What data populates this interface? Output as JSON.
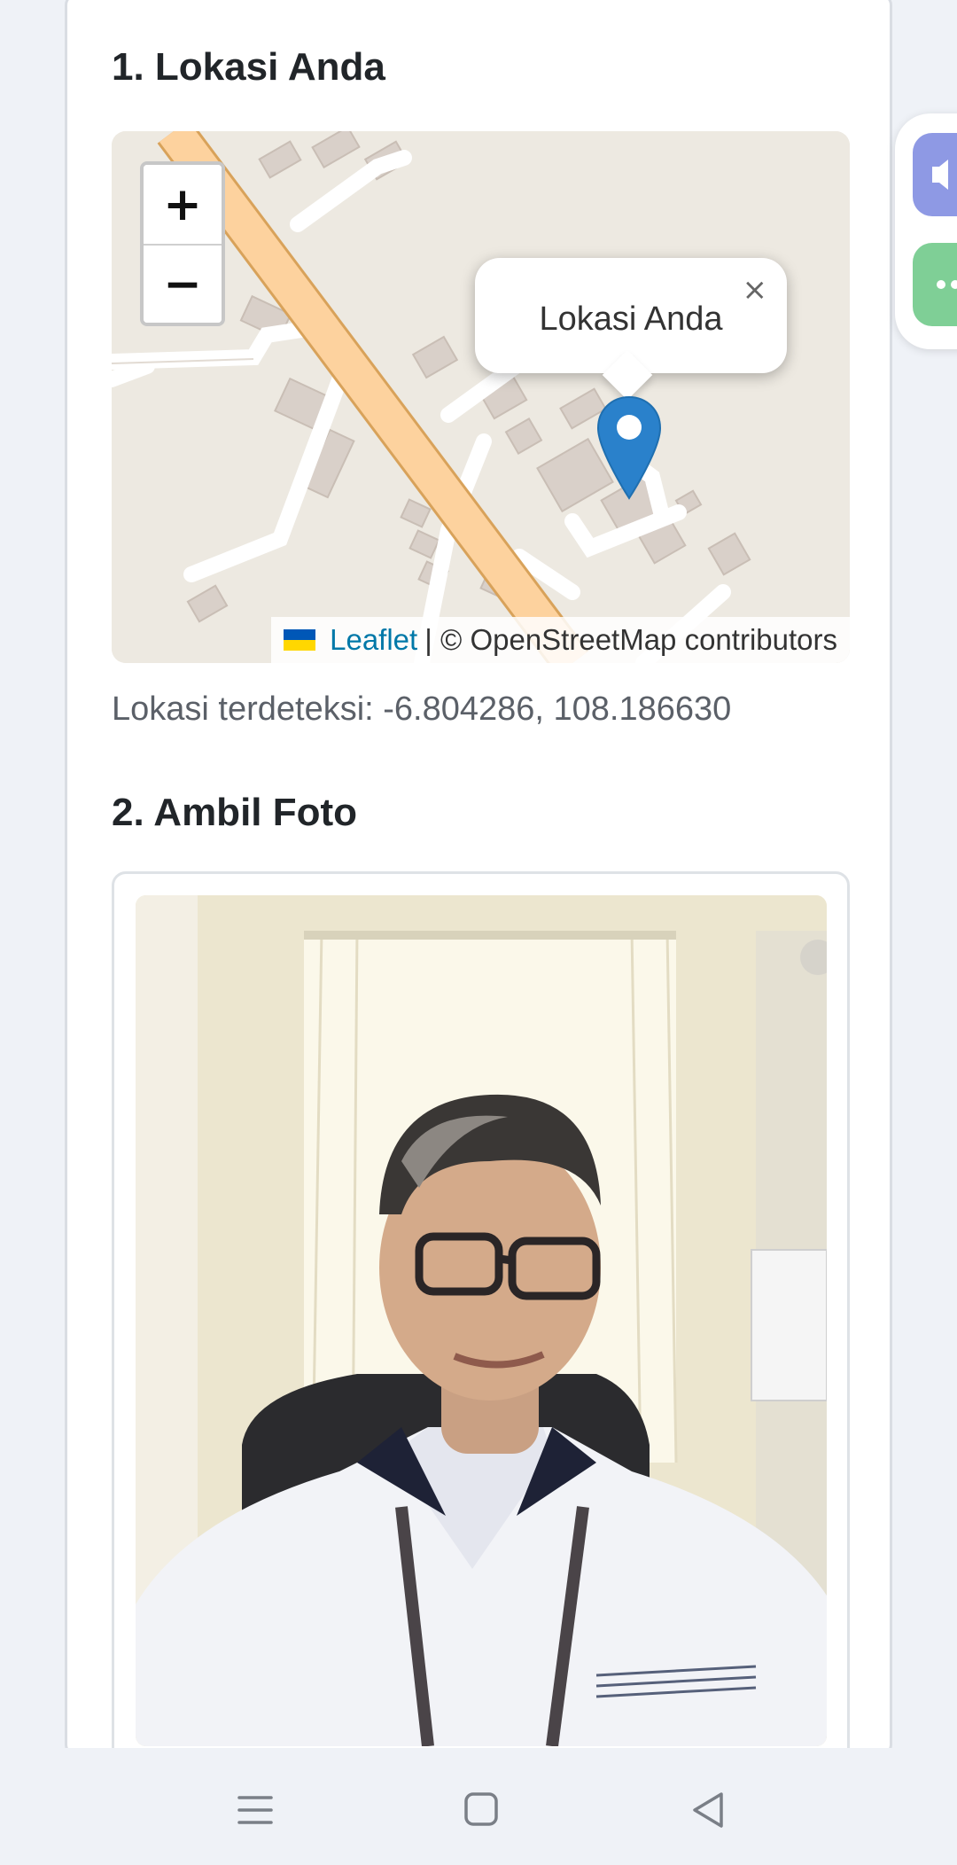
{
  "section1": {
    "title": "1. Lokasi Anda",
    "map": {
      "zoom_in": "+",
      "zoom_out": "−",
      "popup_text": "Lokasi Anda",
      "popup_close": "×",
      "attribution_link": "Leaflet",
      "attribution_text": "| © OpenStreetMap contributors",
      "marker_icon": "map-pin-icon",
      "flag_icon": "ukraine-flag-icon"
    },
    "coordinates_text": "Lokasi terdeteksi: -6.804286, 108.186630"
  },
  "section2": {
    "title": "2. Ambil Foto",
    "photo_alt": "selfie photo"
  },
  "side_panel": {
    "top_icon": "volume-icon",
    "bottom_icon": "more-icon"
  },
  "navbar": {
    "menu_icon": "menu-icon",
    "home_icon": "home-icon",
    "back_icon": "back-icon"
  },
  "colors": {
    "road_major": "#fdd29e",
    "road_minor": "#ffffff",
    "building": "#d9d0c9",
    "land": "#ede9e1",
    "link": "#0078a8",
    "marker": "#2a81cb"
  }
}
